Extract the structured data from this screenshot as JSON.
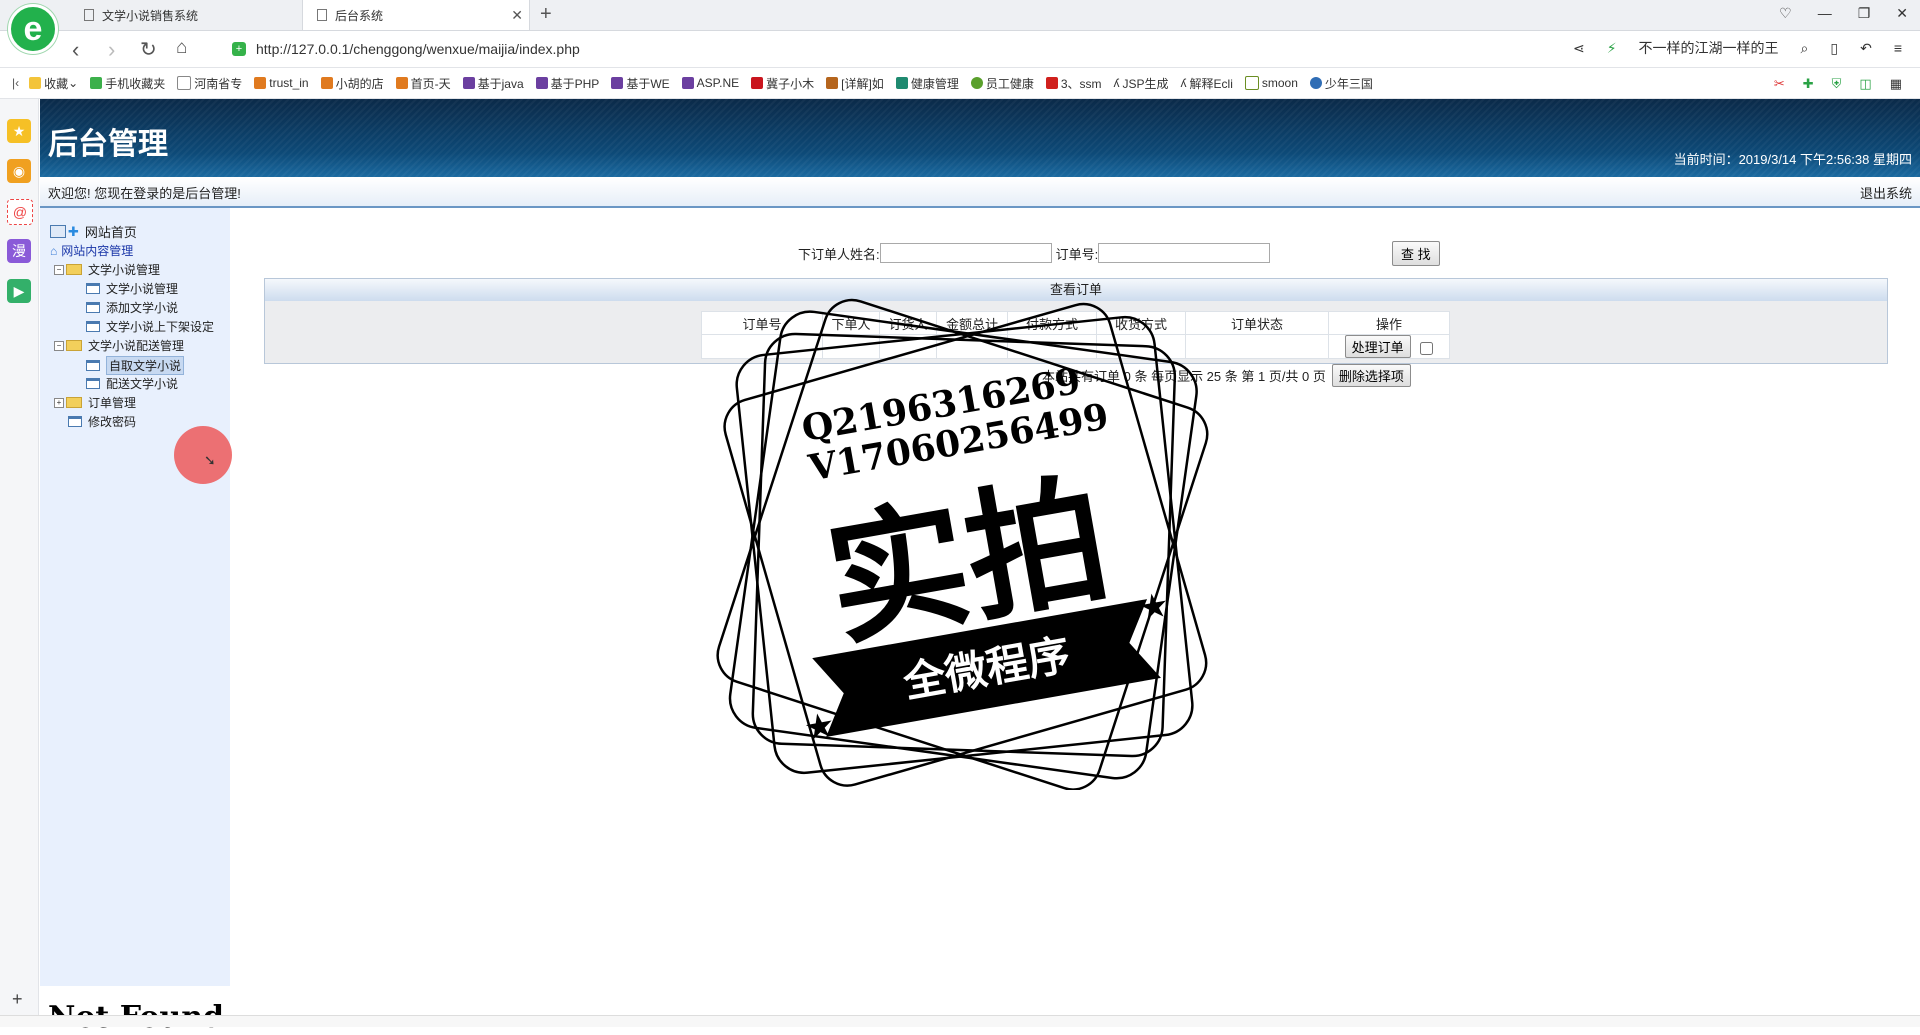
{
  "browser": {
    "logo": "e",
    "tabs": [
      {
        "label": "文学小说销售系统",
        "active": false
      },
      {
        "label": "后台系统",
        "active": true
      }
    ],
    "url": "http://127.0.0.1/chenggong/wenxue/maijia/index.php",
    "search_text": "不一样的江湖一样的王",
    "bookmarks": [
      "收藏",
      "手机收藏夹",
      "河南省专",
      "trust_in",
      "小胡的店",
      "首页-天",
      "基于java",
      "基于PHP",
      "基于WE",
      "ASP.NE",
      "冀子小木",
      "[详解]如",
      "健康管理",
      "员工健康",
      "3、ssm",
      "JSP生成",
      "解释Ecli",
      "smoon",
      "少年三国"
    ]
  },
  "header": {
    "title": "后台管理",
    "time": "当前时间：2019/3/14 下午2:56:38 星期四"
  },
  "welcome": {
    "text": "欢迎您! 您现在登录的是后台管理!",
    "logout": "退出系统"
  },
  "tree": {
    "home": "网站首页",
    "content_mgmt": "网站内容管理",
    "novel_mgmt": "文学小说管理",
    "novel_list": "文学小说管理",
    "novel_add": "添加文学小说",
    "novel_shelf": "文学小说上下架设定",
    "delivery_mgmt": "文学小说配送管理",
    "self_pickup": "自取文学小说",
    "delivery": "配送文学小说",
    "order_mgmt": "订单管理",
    "change_pwd": "修改密码"
  },
  "search": {
    "name_label": "下订单人姓名:",
    "order_label": "订单号:",
    "button": "查 找"
  },
  "orders": {
    "title": "查看订单",
    "columns": [
      "订单号",
      "下单人",
      "订货人",
      "金额总计",
      "付款方式",
      "收货方式",
      "订单状态",
      "操作"
    ],
    "process_button": "处理订单",
    "pager": "本站共有订单 0 条 每页显示 25 条 第 1 页/共 0 页",
    "delete_button": "删除选择项"
  },
  "footer": {
    "not_found": "Not Found"
  },
  "watermark": {
    "line1": "Q2196316269",
    "line2": "V17060256499",
    "big": "实拍",
    "banner": "全微程序"
  }
}
